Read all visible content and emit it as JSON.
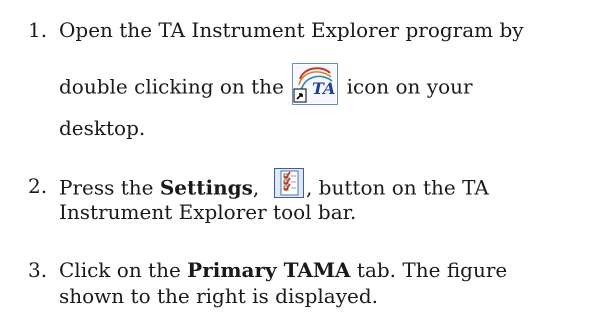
{
  "steps": [
    {
      "number": "1.",
      "line1": "Open the TA Instrument Explorer program by",
      "line2_before": "double clicking on the",
      "line2_after": "icon on your",
      "line3": "desktop.",
      "icon": "ta-instrument-explorer-icon"
    },
    {
      "number": "2.",
      "line1_before": "Press the",
      "line1_bold": "Settings",
      "line1_comma": ",",
      "line1_after": ", button on the TA",
      "line2": "Instrument Explorer tool bar.",
      "icon": "settings-checklist-icon"
    },
    {
      "number": "3.",
      "line1_before": "Click on the",
      "line1_bold": "Primary TAMA",
      "line1_after": "tab. The figure",
      "line2": "shown to the right is displayed."
    }
  ]
}
